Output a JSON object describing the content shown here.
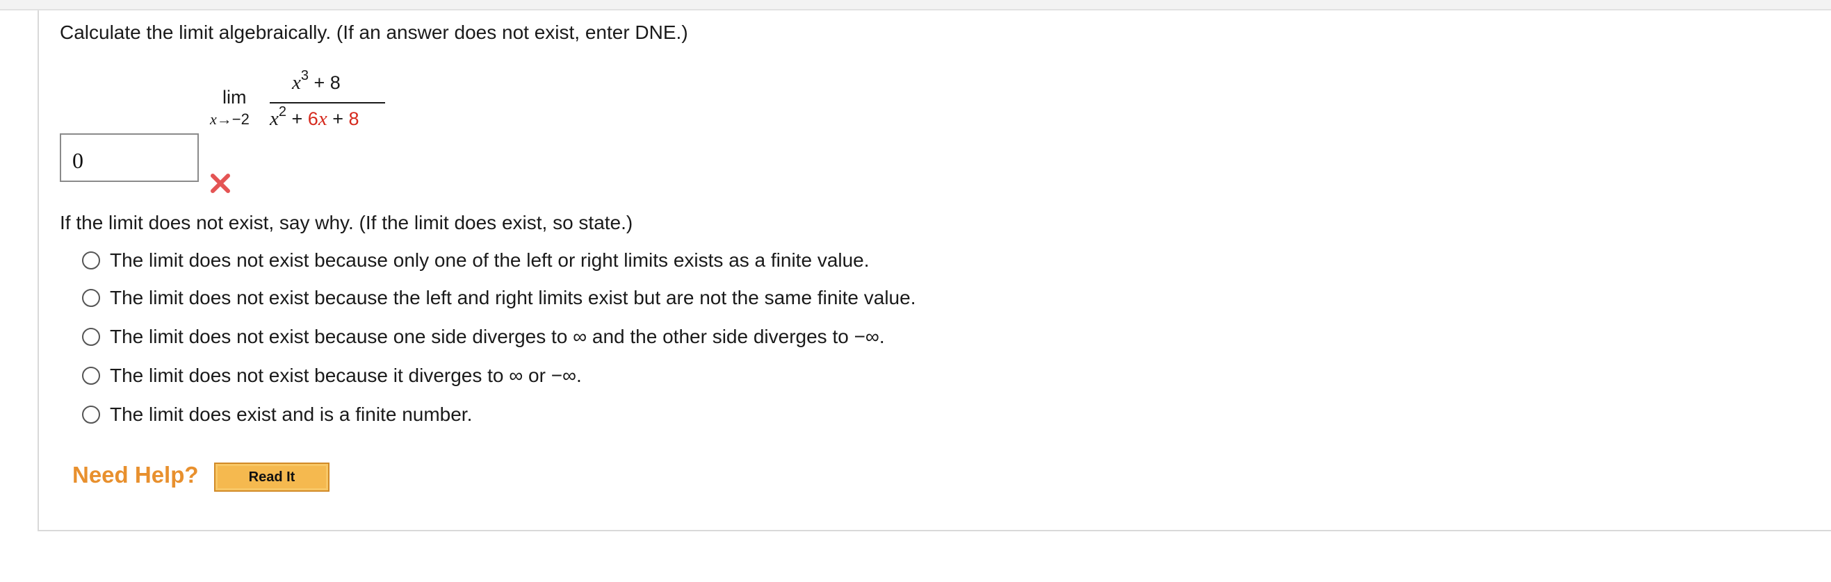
{
  "question": {
    "prompt": "Calculate the limit algebraically. (If an answer does not exist, enter DNE.)",
    "limit": {
      "lim_word": "lim",
      "approach_var": "x",
      "approach_arrow": "→",
      "approach_value": "−2",
      "numerator": {
        "var": "x",
        "exp": "3",
        "rest": " + 8"
      },
      "denominator": {
        "var": "x",
        "exp": "2",
        "plus1": " + ",
        "coef": "6",
        "var2": "x",
        "plus2": " + ",
        "const": "8"
      }
    },
    "answer_value": "0",
    "answer_status": "incorrect",
    "status_color": "#e45454"
  },
  "question_2": {
    "prompt": "If the limit does not exist, say why. (If the limit does exist, so state.)",
    "options": [
      "The limit does not exist because only one of the left or right limits exists as a finite value.",
      "The limit does not exist because the left and right limits exist but are not the same finite value.",
      "The limit does not exist because one side diverges to ∞ and the other side diverges to −∞.",
      "The limit does not exist because it diverges to ∞ or −∞.",
      "The limit does exist and is a finite number."
    ]
  },
  "help": {
    "label": "Need Help?",
    "read_it": "Read It"
  },
  "colors": {
    "accent_red": "#d62a1e",
    "help_orange": "#e8902e",
    "button_fill": "#f5b94f"
  }
}
